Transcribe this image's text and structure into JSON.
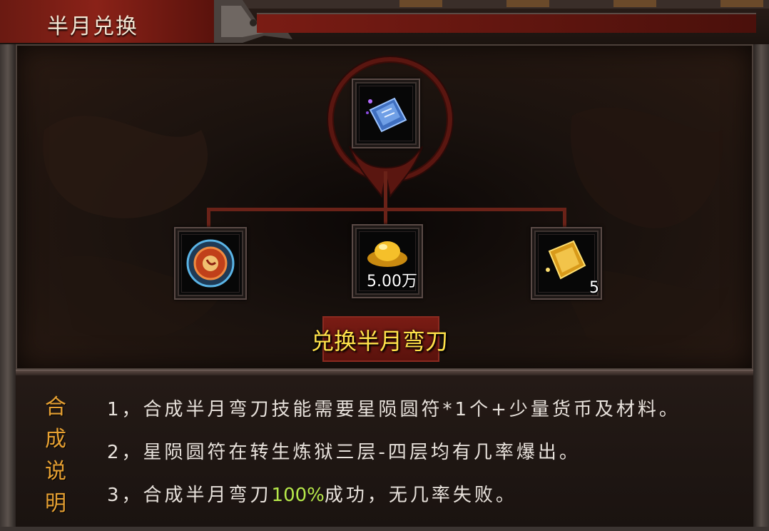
{
  "window": {
    "title": "半月兑换"
  },
  "recipe": {
    "result": {
      "icon": "blue-skill-book-icon"
    },
    "materials": [
      {
        "icon": "star-rune-disc-icon",
        "count": ""
      },
      {
        "icon": "gold-ingot-icon",
        "count": "5.00万"
      },
      {
        "icon": "gold-scroll-fragment-icon",
        "count": "5"
      }
    ],
    "action_label": "兑换半月弯刀"
  },
  "instructions": {
    "label_chars": [
      "合",
      "成",
      "说",
      "明"
    ],
    "lines": [
      {
        "text": "1，合成半月弯刀技能需要星陨圆符*1个+少量货币及材料。"
      },
      {
        "before": "3，合成半月弯刀",
        "highlight": "100%",
        "after": "成功，无几率失败。"
      }
    ],
    "line2": "2，星陨圆符在转生炼狱三层-四层均有几率爆出。"
  },
  "colors": {
    "accent_red": "#7a1c14",
    "button_text": "#ffe24a",
    "label_orange": "#e6a032",
    "highlight_green": "#b6e84a"
  }
}
